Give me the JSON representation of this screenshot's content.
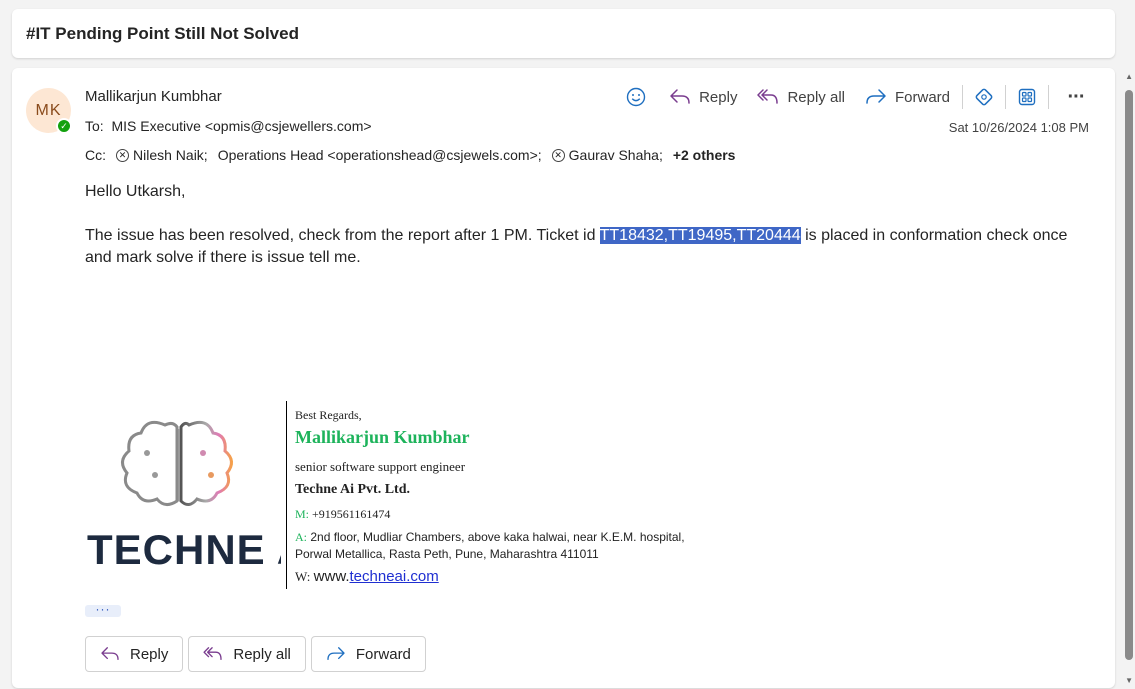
{
  "subject": "#IT Pending Point Still Not Solved",
  "avatar": {
    "initials": "MK",
    "bg_color": "#fde7d4",
    "presence": "available"
  },
  "sender": "Mallikarjun Kumbhar",
  "to": {
    "label": "To:",
    "value": "MIS Executive <opmis@csjewellers.com>"
  },
  "cc": {
    "label": "Cc:",
    "recipients": [
      "Nilesh Naik;",
      "Operations Head <operationshead@csjewels.com>;",
      "Gaurav Shaha;"
    ],
    "others": "+2 others"
  },
  "timestamp": "Sat 10/26/2024 1:08 PM",
  "toolbar": {
    "emoji_icon": "emoji-icon",
    "reply": "Reply",
    "reply_all": "Reply all",
    "forward": "Forward",
    "more": "···"
  },
  "body": {
    "greeting": "Hello Utkarsh,",
    "para_before": "The issue has been resolved, check from the report after 1 PM. Ticket id ",
    "highlight": "TT18432,TT19495,TT20444",
    "para_after": " is placed in conformation check once and mark solve if there is issue tell me."
  },
  "signature": {
    "logo_text": "TECHNE AI",
    "regards": "Best Regards,",
    "name": "Mallikarjun Kumbhar",
    "role": "senior software support engineer",
    "company": "Techne Ai Pvt. Ltd.",
    "mobile_label": "M:",
    "mobile": "+919561161474",
    "address_label": "A:",
    "address_line1": "2nd floor, Mudliar Chambers, above kaka halwai, near K.E.M. hospital,",
    "address_line2": "Porwal Metallica, Rasta Peth, Pune, Maharashtra 411011",
    "web_label": "W:",
    "web_prefix": "www.",
    "web_link": "techneai.com"
  },
  "more_content": "···",
  "bottom_actions": {
    "reply": "Reply",
    "reply_all": "Reply all",
    "forward": "Forward"
  },
  "colors": {
    "accent": "#3f67c6",
    "reply_icon": "#7a3d8f",
    "forward_icon": "#1f6fc0",
    "brand_green": "#1db35b"
  }
}
